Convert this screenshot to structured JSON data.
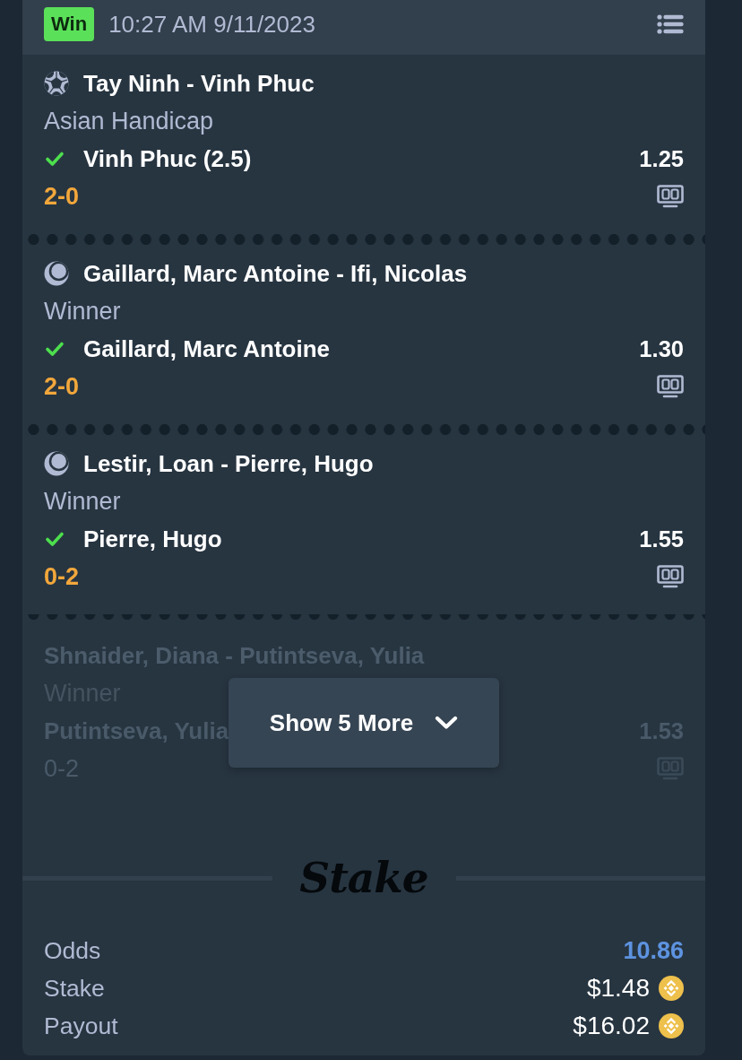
{
  "header": {
    "status": "Win",
    "time": "10:27 AM 9/11/2023"
  },
  "legs": [
    {
      "kind": "soccer",
      "event": "Tay Ninh - Vinh Phuc",
      "market": "Asian Handicap",
      "selection": "Vinh Phuc (2.5)",
      "won": true,
      "odds": "1.25",
      "score": "2-0"
    },
    {
      "kind": "tennis",
      "event": "Gaillard, Marc Antoine - Ifi, Nicolas",
      "market": "Winner",
      "selection": "Gaillard, Marc Antoine",
      "won": true,
      "odds": "1.30",
      "score": "2-0"
    },
    {
      "kind": "tennis",
      "event": "Lestir, Loan - Pierre, Hugo",
      "market": "Winner",
      "selection": "Pierre, Hugo",
      "won": true,
      "odds": "1.55",
      "score": "0-2"
    }
  ],
  "preview": {
    "event": "Shnaider, Diana - Putintseva, Yulia",
    "market": "Winner",
    "selection": "Putintseva, Yulia",
    "odds": "1.53",
    "score": "0-2"
  },
  "show_more": {
    "label": "Show 5 More"
  },
  "brand": {
    "logo": "Stake"
  },
  "summary": [
    {
      "kind": "odds",
      "label": "Odds",
      "value": "10.86"
    },
    {
      "kind": "amount",
      "label": "Stake",
      "value": "$1.48"
    },
    {
      "kind": "amount",
      "label": "Payout",
      "value": "$16.02"
    }
  ]
}
